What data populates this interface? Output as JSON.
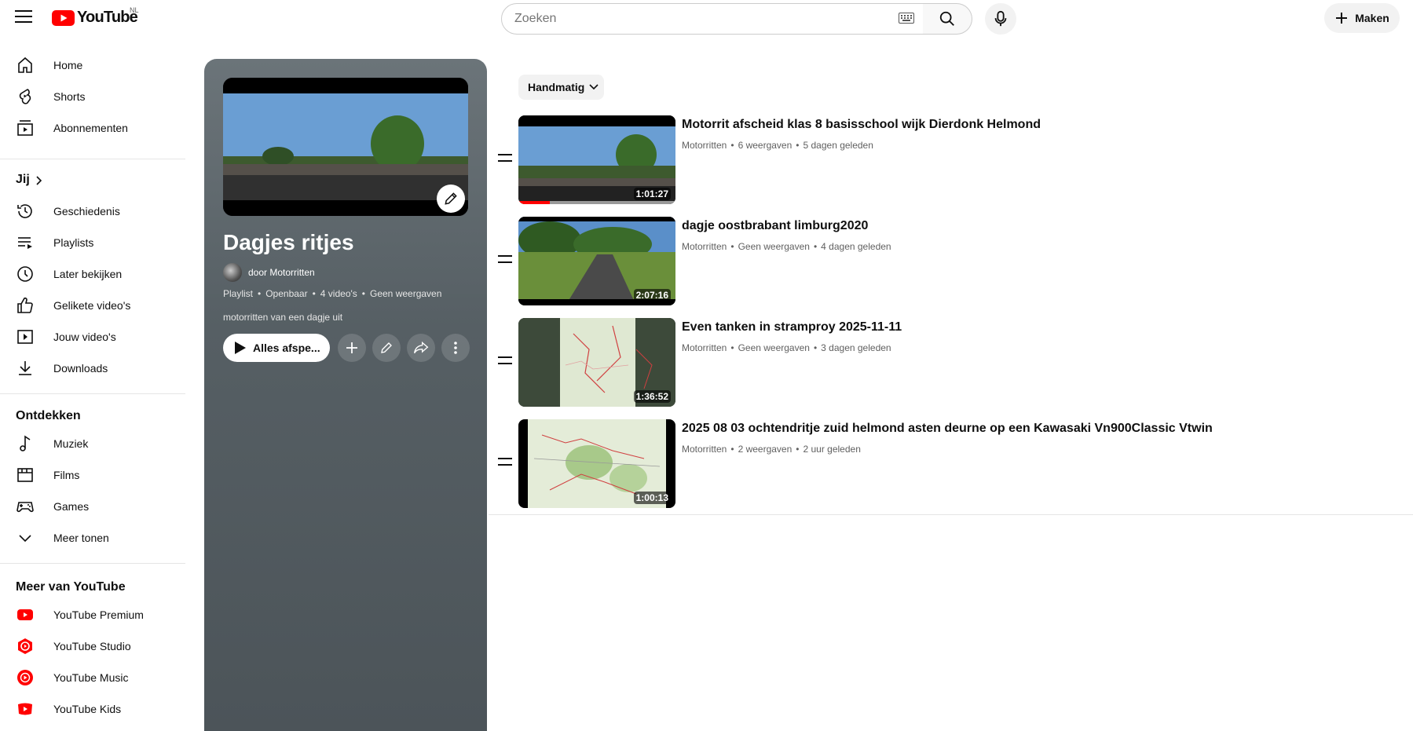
{
  "header": {
    "logo_text": "YouTube",
    "country_code": "NL",
    "search_placeholder": "Zoeken",
    "create_label": "Maken"
  },
  "sidebar": {
    "main": [
      {
        "label": "Home",
        "icon": "home-icon"
      },
      {
        "label": "Shorts",
        "icon": "shorts-icon"
      },
      {
        "label": "Abonnementen",
        "icon": "subscriptions-icon"
      }
    ],
    "you_heading": "Jij",
    "you": [
      {
        "label": "Geschiedenis",
        "icon": "history-icon"
      },
      {
        "label": "Playlists",
        "icon": "playlists-icon"
      },
      {
        "label": "Later bekijken",
        "icon": "watch-later-icon"
      },
      {
        "label": "Gelikete video's",
        "icon": "liked-icon"
      },
      {
        "label": "Jouw video's",
        "icon": "your-videos-icon"
      },
      {
        "label": "Downloads",
        "icon": "downloads-icon"
      }
    ],
    "explore_heading": "Ontdekken",
    "explore": [
      {
        "label": "Muziek",
        "icon": "music-icon"
      },
      {
        "label": "Films",
        "icon": "films-icon"
      },
      {
        "label": "Games",
        "icon": "games-icon"
      },
      {
        "label": "Meer tonen",
        "icon": "chevron-down-icon"
      }
    ],
    "more_heading": "Meer van YouTube",
    "more": [
      {
        "label": "YouTube Premium",
        "icon": "youtube-premium-icon"
      },
      {
        "label": "YouTube Studio",
        "icon": "youtube-studio-icon"
      },
      {
        "label": "YouTube Music",
        "icon": "youtube-music-icon"
      },
      {
        "label": "YouTube Kids",
        "icon": "youtube-kids-icon"
      }
    ]
  },
  "playlist": {
    "title": "Dagjes ritjes",
    "owner": "door Motorritten",
    "meta": [
      "Playlist",
      "Openbaar",
      "4 video's",
      "Geen weergaven"
    ],
    "description": "motorritten van een dagje uit",
    "play_all_label": "Alles afspe...",
    "sort_label": "Handmatig"
  },
  "videos": [
    {
      "title": "Motorrit afscheid klas 8 basisschool wijk Dierdonk Helmond",
      "channel": "Motorritten",
      "views": "6 weergaven",
      "age": "5 dagen geleden",
      "duration": "1:01:27",
      "watched_fraction": 0.2,
      "thumb": "road"
    },
    {
      "title": "dagje oostbrabant limburg2020",
      "channel": "Motorritten",
      "views": "Geen weergaven",
      "age": "4 dagen geleden",
      "duration": "2:07:16",
      "watched_fraction": 0,
      "thumb": "trees"
    },
    {
      "title": "Even tanken in stramproy 2025-11-11",
      "channel": "Motorritten",
      "views": "Geen weergaven",
      "age": "3 dagen geleden",
      "duration": "1:36:52",
      "watched_fraction": 0,
      "thumb": "map-dark"
    },
    {
      "title": "2025 08 03 ochtendritje zuid helmond asten deurne op een Kawasaki Vn900Classic Vtwin",
      "channel": "Motorritten",
      "views": "2 weergaven",
      "age": "2 uur geleden",
      "duration": "1:00:13",
      "watched_fraction": 0,
      "thumb": "map-light"
    }
  ],
  "colors": {
    "brand_red": "#ff0000",
    "panel": "#545c61"
  }
}
